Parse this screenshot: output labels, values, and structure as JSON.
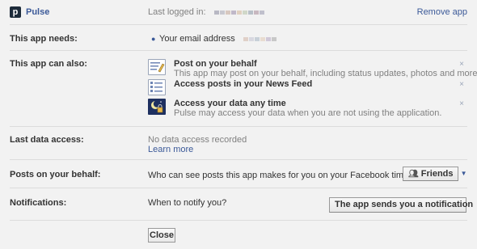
{
  "header": {
    "app_icon_letter": "p",
    "app_name": "Pulse",
    "last_logged_label": "Last logged in:",
    "remove_label": "Remove app"
  },
  "needs": {
    "label": "This app needs:",
    "item": "Your email address"
  },
  "also": {
    "label": "This app can also:",
    "permissions": [
      {
        "title": "Post on your behalf",
        "desc": "This app may post on your behalf, including status updates, photos and more.",
        "icon": "post-icon"
      },
      {
        "title": "Access posts in your News Feed",
        "desc": "",
        "icon": "news-feed-icon"
      },
      {
        "title": "Access your data any time",
        "desc": "Pulse may access your data when you are not using the application.",
        "icon": "moon-lock-icon"
      }
    ],
    "remove_symbol": "×"
  },
  "data_access": {
    "label": "Last data access:",
    "value": "No data access recorded",
    "learn_more": "Learn more"
  },
  "posts": {
    "label": "Posts on your behalf:",
    "question": "Who can see posts this app makes for you on your Facebook timeline?",
    "audience": "Friends",
    "audience_icon": "friends-icon"
  },
  "notifications": {
    "label": "Notifications:",
    "question": "When to notify you?",
    "selected": "The app sends you a notification"
  },
  "footer": {
    "close_label": "Close"
  },
  "colors": {
    "link": "#3b5998",
    "background": "#f2f2f2"
  }
}
